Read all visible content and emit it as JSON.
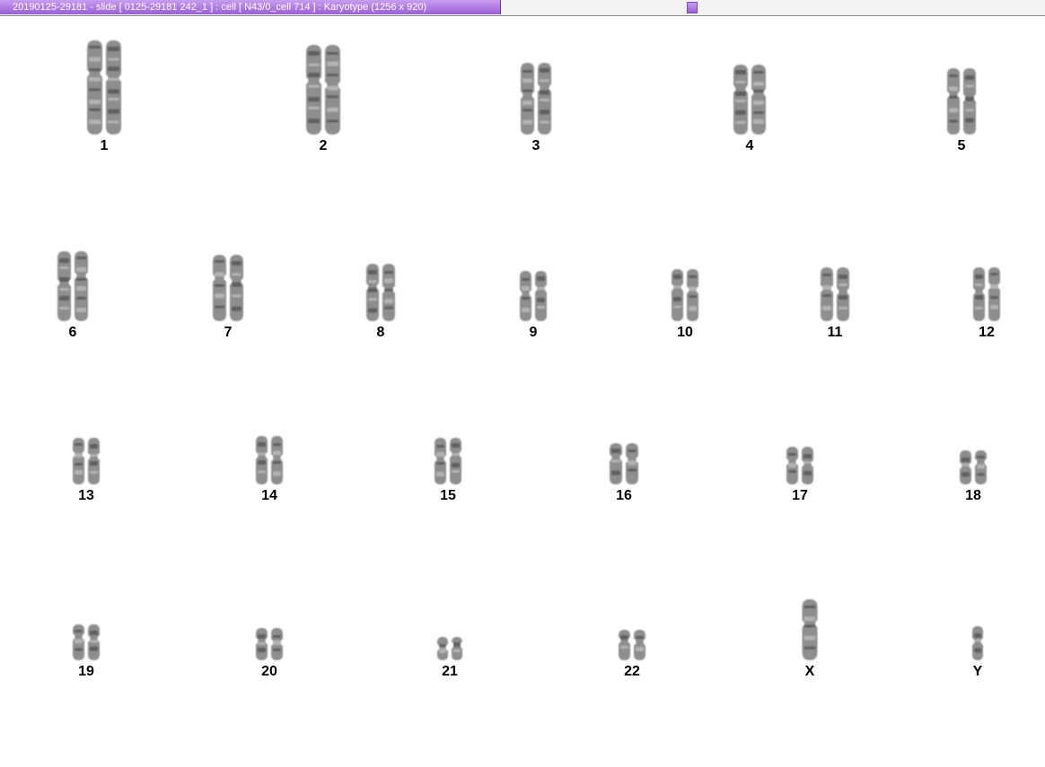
{
  "window": {
    "title": "20190125-29181 - slide [ 0125-29181 242_1 ] : cell [ N43/0_cell 714 ] : Karyotype  (1256 x 920)"
  },
  "chromosomes": [
    {
      "label": "1"
    },
    {
      "label": "2"
    },
    {
      "label": "3"
    },
    {
      "label": "4"
    },
    {
      "label": "5"
    },
    {
      "label": "6"
    },
    {
      "label": "7"
    },
    {
      "label": "8"
    },
    {
      "label": "9"
    },
    {
      "label": "10"
    },
    {
      "label": "11"
    },
    {
      "label": "12"
    },
    {
      "label": "13"
    },
    {
      "label": "14"
    },
    {
      "label": "15"
    },
    {
      "label": "16"
    },
    {
      "label": "17"
    },
    {
      "label": "18"
    },
    {
      "label": "19"
    },
    {
      "label": "20"
    },
    {
      "label": "21"
    },
    {
      "label": "22"
    },
    {
      "label": "X"
    },
    {
      "label": "Y"
    }
  ]
}
